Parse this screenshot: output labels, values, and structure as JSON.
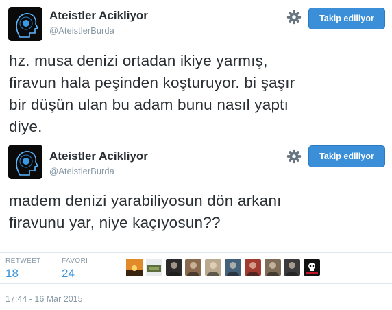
{
  "tweets": [
    {
      "name": "Ateistler Acikliyor",
      "handle": "@AteistlerBurda",
      "follow_label": "Takip ediliyor",
      "text_lines": [
        "hz. musa denizi ortadan ikiye yarmış,",
        "firavun hala peşinden koşturuyor. bi şaşır",
        "bir düşün ulan bu adam bunu nasıl yaptı",
        "diye."
      ]
    },
    {
      "name": "Ateistler Acikliyor",
      "handle": "@AteistlerBurda",
      "follow_label": "Takip ediliyor",
      "text_lines": [
        "madem denizi yarabiliyosun dön arkanı",
        "firavunu yar, niye kaçıyosun??"
      ]
    }
  ],
  "stats": {
    "retweet_label": "RETWEET",
    "retweet_count": "18",
    "favorite_label": "FAVORİ",
    "favorite_count": "24"
  },
  "favoriters": [
    {
      "icon": "sunset-avatar",
      "color": "#c46a22"
    },
    {
      "icon": "landscape-avatar",
      "color": "#6c7a52"
    },
    {
      "icon": "portrait-avatar",
      "color": "#2a2a2a"
    },
    {
      "icon": "portrait-avatar",
      "color": "#8a6a4e"
    },
    {
      "icon": "portrait-avatar",
      "color": "#b9a98e"
    },
    {
      "icon": "portrait-avatar",
      "color": "#44617a"
    },
    {
      "icon": "portrait-avatar",
      "color": "#a13b32"
    },
    {
      "icon": "portrait-avatar",
      "color": "#7c6c58"
    },
    {
      "icon": "portrait-avatar",
      "color": "#3a3a3a"
    },
    {
      "icon": "skull-avatar",
      "color": "#111111"
    }
  ],
  "timestamp": "17:44 - 16 Mar 2015",
  "colors": {
    "accent": "#3b94d9",
    "follow_bg": "#3a8fd8"
  }
}
